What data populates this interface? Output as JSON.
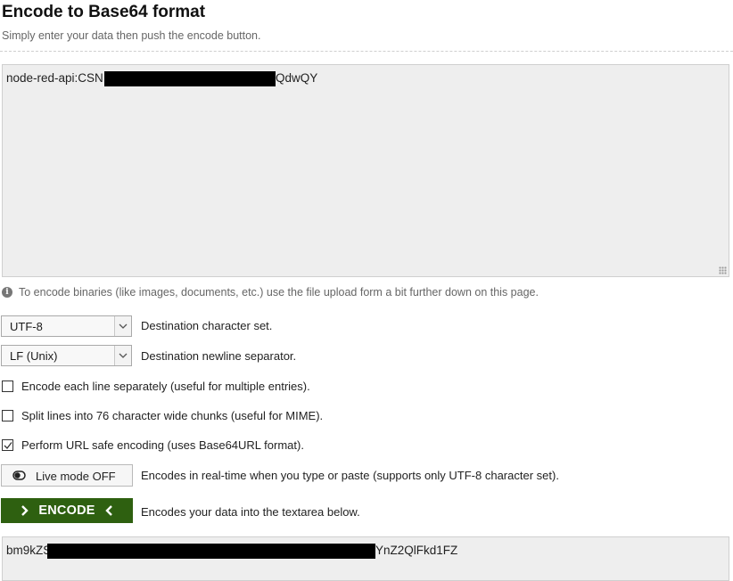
{
  "header": {
    "title": "Encode to Base64 format",
    "subtitle": "Simply enter your data then push the encode button."
  },
  "input": {
    "text_before": "node-red-api:CSN",
    "text_after": "QdwQY"
  },
  "note": {
    "icon": "info-icon",
    "text": "To encode binaries (like images, documents, etc.) use the file upload form a bit further down on this page."
  },
  "charset": {
    "value": "UTF-8",
    "label": "Destination character set."
  },
  "newline": {
    "value": "LF (Unix)",
    "label": "Destination newline separator."
  },
  "options": {
    "each_line": {
      "label": "Encode each line separately (useful for multiple entries).",
      "checked": false
    },
    "split_lines": {
      "label": "Split lines into 76 character wide chunks (useful for MIME).",
      "checked": false
    },
    "url_safe": {
      "label": "Perform URL safe encoding (uses Base64URL format).",
      "checked": true
    }
  },
  "live_mode": {
    "button_label": "Live mode OFF",
    "icon": "toggle-off-icon",
    "description": "Encodes in real-time when you type or paste (supports only UTF-8 character set)."
  },
  "encode": {
    "button_label": "ENCODE",
    "description": "Encodes your data into the textarea below."
  },
  "output": {
    "text_before": "bm9kZS",
    "text_after": "YnZ2QlFkd1FZ"
  }
}
